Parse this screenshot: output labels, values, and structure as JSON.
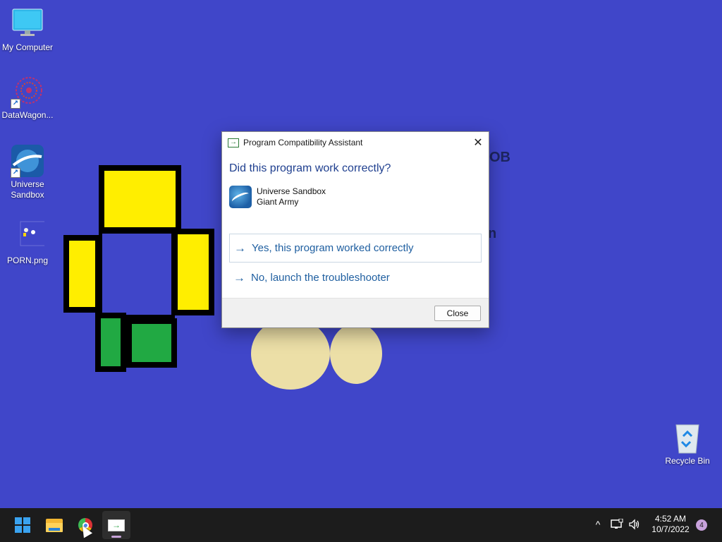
{
  "desktop": {
    "icons": [
      {
        "label": "My Computer"
      },
      {
        "label": "DataWagon..."
      },
      {
        "label": "Universe Sandbox"
      },
      {
        "label": "PORN.png"
      },
      {
        "label": "Recycle Bin"
      }
    ],
    "background_color": "#4046c9",
    "background_text": [
      "OB",
      "n"
    ]
  },
  "dialog": {
    "title": "Program Compatibility Assistant",
    "heading": "Did this program work correctly?",
    "program_name": "Universe Sandbox",
    "program_publisher": "Giant Army",
    "option_yes": "Yes, this program worked correctly",
    "option_no": "No, launch the troubleshooter",
    "close_button": "Close",
    "close_glyph": "✕",
    "arrow_glyph": "→"
  },
  "taskbar": {
    "apps": [
      {
        "name": "start-button",
        "icon": "windows-logo-icon"
      },
      {
        "name": "file-explorer",
        "icon": "folder-icon"
      },
      {
        "name": "chrome",
        "icon": "chrome-icon"
      },
      {
        "name": "program-compatibility-assistant",
        "icon": "pca-icon",
        "active": true
      }
    ],
    "tray": {
      "chevron": "^",
      "time": "4:52 AM",
      "date": "10/7/2022",
      "notifications": "4"
    }
  },
  "colors": {
    "accent_blue": "#1f5fa0",
    "heading_blue": "#1f3f8f",
    "taskbar": "#1c1c1c",
    "wallpaper_yellow": "#ffee00",
    "wallpaper_green": "#21a943",
    "wallpaper_beige": "#ecdfa7"
  }
}
